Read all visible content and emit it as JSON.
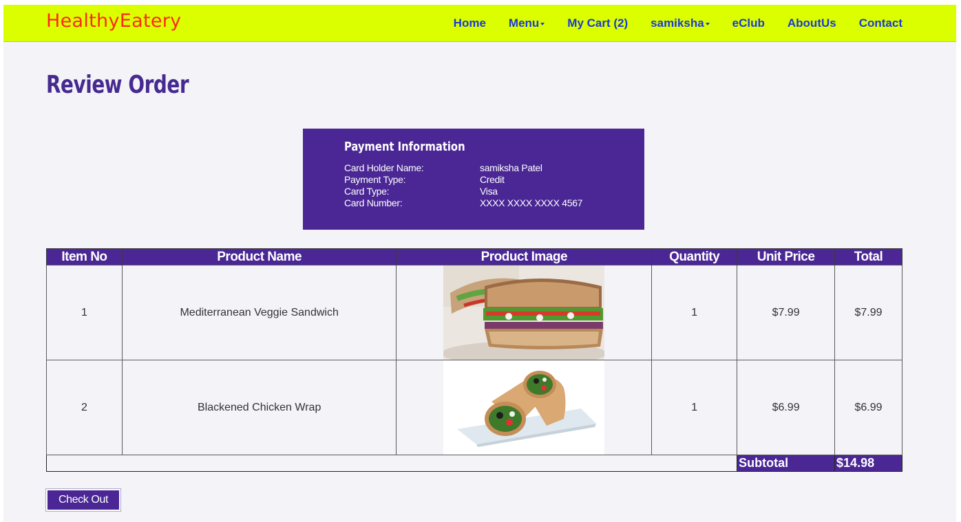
{
  "brand": "HealthyEatery",
  "nav": {
    "home": "Home",
    "menu": "Menu",
    "cart": "My Cart (2)",
    "user": "samiksha",
    "eclub": "eClub",
    "about": "AboutUs",
    "contact": "Contact"
  },
  "page_title": "Review Order",
  "payment": {
    "title": "Payment Information",
    "rows": [
      {
        "label": "Card Holder Name:",
        "value": "samiksha Patel"
      },
      {
        "label": "Payment Type:",
        "value": "Credit"
      },
      {
        "label": "Card Type:",
        "value": "Visa"
      },
      {
        "label": "Card Number:",
        "value": "XXXX XXXX XXXX 4567"
      }
    ]
  },
  "table": {
    "headers": [
      "Item No",
      "Product Name",
      "Product Image",
      "Quantity",
      "Unit Price",
      "Total"
    ],
    "rows": [
      {
        "item_no": "1",
        "name": "Mediterranean Veggie Sandwich",
        "image": "sandwich-image",
        "quantity": "1",
        "unit_price": "$7.99",
        "total": "$7.99"
      },
      {
        "item_no": "2",
        "name": "Blackened Chicken Wrap",
        "image": "wrap-image",
        "quantity": "1",
        "unit_price": "$6.99",
        "total": "$6.99"
      }
    ],
    "subtotal_label": "Subtotal",
    "subtotal_value": "$14.98"
  },
  "checkout_label": "Check Out",
  "colors": {
    "navbar_bg": "#dcff00",
    "brand": "#ff2a1a",
    "nav_link": "#1a3ad8",
    "accent": "#4a2795",
    "page_bg": "#f3f3f8"
  }
}
